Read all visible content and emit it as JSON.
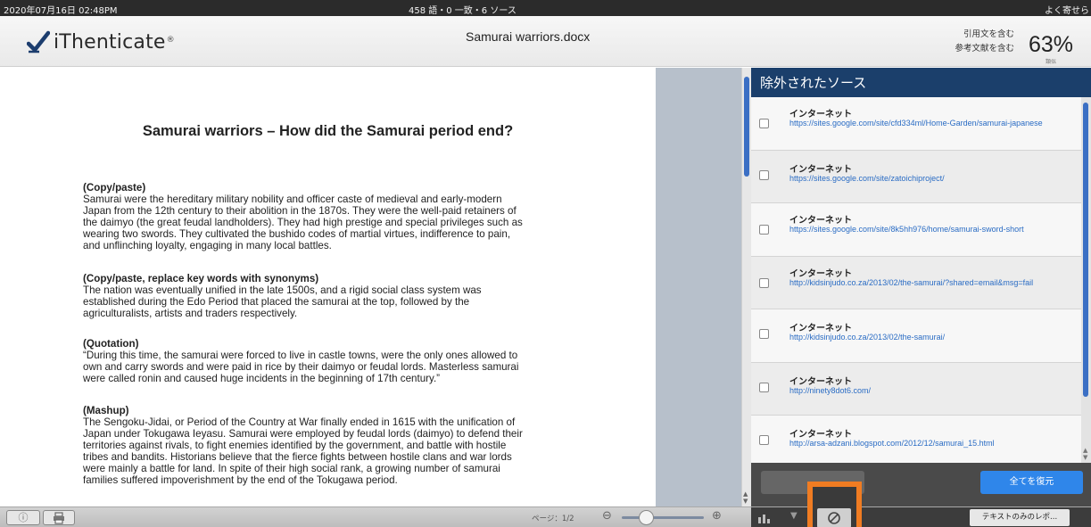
{
  "statusbar": {
    "timestamp": "2020年07月16日 02:48PM",
    "summary": "458 語・0 一致・6 ソース",
    "right_text": "よく寄せら"
  },
  "header": {
    "logo_text": "iThenticate",
    "logo_mark": "®",
    "document_title": "Samurai warriors.docx",
    "filters": [
      "引用文を含む",
      "参考文献を含む"
    ],
    "similarity_value": "63%",
    "similarity_label": "類似"
  },
  "document": {
    "heading": "Samurai warriors – How did the Samurai period end?",
    "sections": [
      {
        "title": "(Copy/paste)",
        "lines": [
          "Samurai were the hereditary military nobility and officer caste of medieval and early-modern",
          "Japan from the 12th century to their abolition in the 1870s. They were the well-paid retainers of",
          "the daimyo (the great feudal landholders). They had high prestige and special privileges such as",
          "wearing two swords. They cultivated the bushido codes of martial virtues, indifference to pain,",
          "and unflinching loyalty, engaging in many local battles."
        ]
      },
      {
        "title": "(Copy/paste, replace key words with synonyms)",
        "lines": [
          "The nation was eventually unified in the late 1500s, and a rigid social class system was",
          "established during the Edo Period that placed the samurai at the top, followed by the",
          "agriculturalists, artists and traders respectively."
        ]
      },
      {
        "title": "(Quotation)",
        "lines": [
          "“During this time, the samurai were forced to live in castle towns, were the only ones allowed to",
          "own and carry swords and were paid in rice by their daimyo or feudal lords. Masterless samurai",
          "were called ronin and caused huge incidents in the beginning of 17th century.”"
        ]
      },
      {
        "title": "(Mashup)",
        "lines": [
          "The Sengoku-Jidai, or Period of the Country at War finally ended in 1615 with the unification of",
          "Japan under Tokugawa Ieyasu. Samurai were employed by feudal lords (daimyo) to defend their",
          "territories against rivals, to fight enemies identified by the government, and battle with hostile",
          "tribes and bandits. Historians believe that the fierce fights between hostile clans and war lords",
          "were mainly a battle for land. In spite of their high social rank, a growing number of samurai",
          "families suffered impoverishment by the end of the Tokugawa period."
        ]
      }
    ]
  },
  "panel": {
    "title": "除外されたソース",
    "sources": [
      {
        "type": "インターネット",
        "url": "https://sites.google.com/site/cfd334ml/Home-Garden/samurai-japanese"
      },
      {
        "type": "インターネット",
        "url": "https://sites.google.com/site/zatoichiproject/"
      },
      {
        "type": "インターネット",
        "url": "https://sites.google.com/site/8k5hh976/home/samurai-sword-short"
      },
      {
        "type": "インターネット",
        "url": "http://kidsinjudo.co.za/2013/02/the-samurai/?shared=email&msg=fail"
      },
      {
        "type": "インターネット",
        "url": "http://kidsinjudo.co.za/2013/02/the-samurai/"
      },
      {
        "type": "インターネット",
        "url": "http://ninety8dot6.com/"
      },
      {
        "type": "インターネット",
        "url": "http://arsa-adzani.blogspot.com/2012/12/samurai_15.html"
      }
    ],
    "restore_all_label": "全てを復元"
  },
  "bottombar": {
    "page_indicator": "ページ：1/2",
    "text_only_label": "テキストのみのレポ..."
  },
  "colors": {
    "panel_header": "#1b3f6b",
    "restore_button": "#2f86ea",
    "highlight_outline": "#f07c22",
    "link": "#2a6cc4"
  },
  "icons": [
    "checkmark-logo-icon",
    "info-icon",
    "print-icon",
    "zoom-out-icon",
    "zoom-in-icon",
    "chart-icon",
    "filter-icon",
    "exclude-sources-icon"
  ]
}
